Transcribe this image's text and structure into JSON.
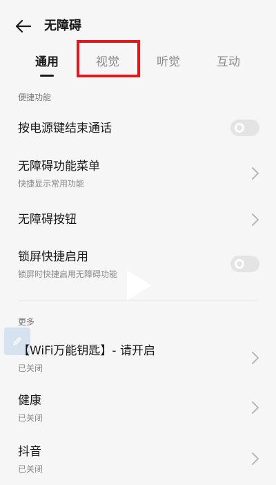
{
  "header": {
    "title": "无障碍",
    "back_icon": "arrow-left-icon"
  },
  "tabs": [
    {
      "label": "通用",
      "active": true
    },
    {
      "label": "视觉",
      "active": false,
      "highlighted": true
    },
    {
      "label": "听觉",
      "active": false
    },
    {
      "label": "互动",
      "active": false
    }
  ],
  "sections": {
    "shortcuts": {
      "label": "便捷功能",
      "items": [
        {
          "title": "按电源键结束通话",
          "control": "toggle",
          "enabled": false
        },
        {
          "title": "无障碍功能菜单",
          "subtitle": "快捷显示常用功能",
          "control": "chevron"
        },
        {
          "title": "无障碍按钮",
          "control": "chevron"
        },
        {
          "title": "锁屏快捷启用",
          "subtitle": "锁屏时快捷启用无障碍功能",
          "control": "toggle",
          "enabled": false
        }
      ]
    },
    "more": {
      "label": "更多",
      "items": [
        {
          "title": "【WiFi万能钥匙】- 请开启",
          "subtitle": "已关闭",
          "control": "chevron"
        },
        {
          "title": "健康",
          "subtitle": "已关闭",
          "control": "chevron"
        },
        {
          "title": "抖音",
          "subtitle": "已关闭",
          "control": "chevron"
        }
      ]
    }
  },
  "colors": {
    "background": "#f6f6f6",
    "highlight_box": "#e0191f",
    "toggle_off": "#e4e4e4"
  }
}
